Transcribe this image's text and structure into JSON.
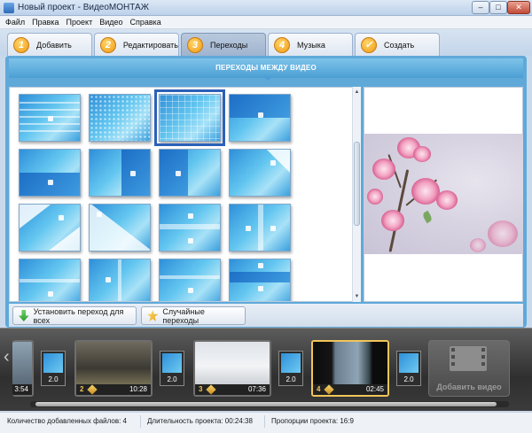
{
  "window": {
    "title": "Новый проект - ВидеоМОНТАЖ",
    "min": "–",
    "max": "□",
    "close": "✕"
  },
  "menu": [
    "Файл",
    "Правка",
    "Проект",
    "Видео",
    "Справка"
  ],
  "tabs": [
    {
      "num": "1",
      "label": "Добавить",
      "active": false
    },
    {
      "num": "2",
      "label": "Редактировать",
      "active": false
    },
    {
      "num": "3",
      "label": "Переходы",
      "active": true
    },
    {
      "num": "4",
      "label": "Музыка",
      "active": false
    },
    {
      "num": "✓",
      "label": "Создать",
      "active": false
    }
  ],
  "section_title": "ПЕРЕХОДЫ МЕЖДУ ВИДЕО",
  "transitions_selected_index": 2,
  "scroll": {
    "up": "▲",
    "down": "▼"
  },
  "actions": {
    "set_all": "Установить переход для всех",
    "random": "Случайные переходы"
  },
  "timeline": {
    "left_arrow": "‹",
    "first_clip_dur": "3:54",
    "clips": [
      {
        "num": "2",
        "duration": "10:28",
        "selected": false
      },
      {
        "num": "3",
        "duration": "07:36",
        "selected": false
      },
      {
        "num": "4",
        "duration": "02:45",
        "selected": true
      }
    ],
    "transitions": [
      "2.0",
      "2.0",
      "2.0",
      "2.0"
    ],
    "add_video": "Добавить видео"
  },
  "status": {
    "files": "Количество добавленных файлов: 4",
    "duration": "Длительность проекта:  00:24:38",
    "ratio": "Пропорции проекта:  16:9"
  },
  "colors": {
    "accent": "#4b9fd4",
    "tab_badge": "#f09a15",
    "selected_clip": "#f1c55a"
  }
}
